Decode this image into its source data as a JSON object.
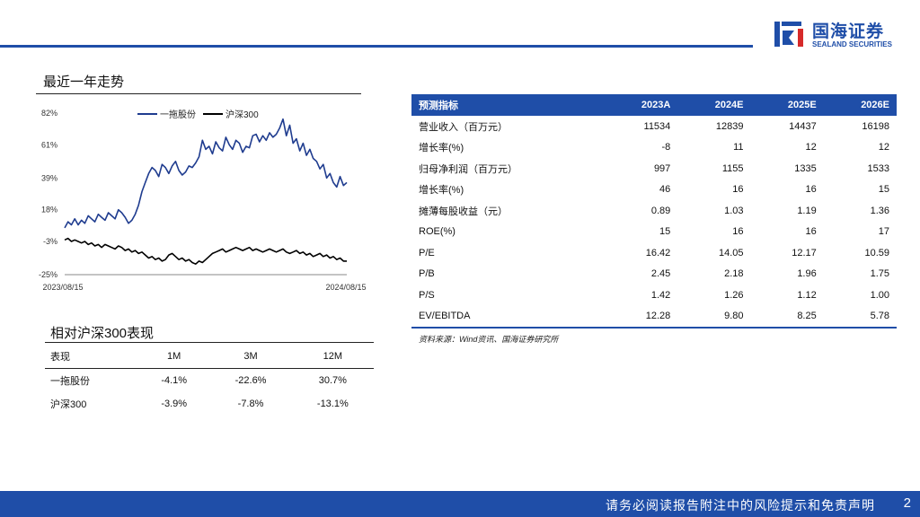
{
  "brand": {
    "name_cn": "国海证券",
    "name_en": "SEALAND SECURITIES",
    "color": "#1f4ea8"
  },
  "chart_section": {
    "title": "最近一年走势"
  },
  "chart_data": {
    "type": "line",
    "title": "最近一年走势",
    "y_ticks": [
      "82%",
      "61%",
      "39%",
      "18%",
      "-3%",
      "-25%"
    ],
    "y_tick_values": [
      82,
      61,
      39,
      18,
      -3,
      -25
    ],
    "ylim": [
      -25,
      82
    ],
    "x_tick_labels": [
      "2023/08/15",
      "2024/08/15"
    ],
    "legend_position": "top-right",
    "series": [
      {
        "name": "一拖股份",
        "color": "#1f3c8f",
        "values": [
          6,
          10,
          8,
          12,
          8,
          11,
          9,
          14,
          12,
          10,
          15,
          13,
          11,
          16,
          14,
          12,
          18,
          16,
          13,
          9,
          11,
          15,
          21,
          30,
          36,
          42,
          46,
          44,
          40,
          48,
          46,
          42,
          47,
          50,
          44,
          41,
          43,
          47,
          46,
          49,
          53,
          64,
          58,
          60,
          55,
          63,
          59,
          57,
          66,
          61,
          58,
          64,
          62,
          56,
          60,
          59,
          67,
          68,
          63,
          67,
          64,
          69,
          66,
          68,
          72,
          78,
          67,
          74,
          62,
          65,
          57,
          62,
          54,
          58,
          52,
          50,
          45,
          48,
          39,
          42,
          36,
          33,
          40,
          34,
          36
        ]
      },
      {
        "name": "沪深300",
        "color": "#000000",
        "values": [
          -2,
          -1,
          -3,
          -2,
          -3,
          -4,
          -3,
          -5,
          -4,
          -6,
          -5,
          -7,
          -5,
          -6,
          -7,
          -8,
          -6,
          -7,
          -9,
          -8,
          -10,
          -9,
          -11,
          -10,
          -12,
          -14,
          -13,
          -15,
          -14,
          -16,
          -15,
          -12,
          -11,
          -13,
          -15,
          -14,
          -16,
          -15,
          -17,
          -18,
          -16,
          -17,
          -15,
          -13,
          -11,
          -10,
          -9,
          -8,
          -10,
          -9,
          -8,
          -7,
          -8,
          -9,
          -8,
          -7,
          -9,
          -8,
          -9,
          -10,
          -9,
          -8,
          -9,
          -10,
          -9,
          -8,
          -10,
          -11,
          -10,
          -9,
          -11,
          -10,
          -12,
          -11,
          -13,
          -12,
          -11,
          -13,
          -12,
          -14,
          -13,
          -15,
          -14,
          -16,
          -16
        ]
      }
    ]
  },
  "perf_section": {
    "title": "相对沪深300表现",
    "headers": [
      "表现",
      "1M",
      "3M",
      "12M"
    ],
    "rows": [
      [
        "一拖股份",
        "-4.1%",
        "-22.6%",
        "30.7%"
      ],
      [
        "沪深300",
        "-3.9%",
        "-7.8%",
        "-13.1%"
      ]
    ]
  },
  "forecast": {
    "headers": [
      "预测指标",
      "2023A",
      "2024E",
      "2025E",
      "2026E"
    ],
    "rows": [
      [
        "营业收入（百万元）",
        "11534",
        "12839",
        "14437",
        "16198"
      ],
      [
        "增长率(%)",
        "-8",
        "11",
        "12",
        "12"
      ],
      [
        "归母净利润（百万元）",
        "997",
        "1155",
        "1335",
        "1533"
      ],
      [
        "增长率(%)",
        "46",
        "16",
        "16",
        "15"
      ],
      [
        "摊薄每股收益（元）",
        "0.89",
        "1.03",
        "1.19",
        "1.36"
      ],
      [
        "ROE(%)",
        "15",
        "16",
        "16",
        "17"
      ],
      [
        "P/E",
        "16.42",
        "14.05",
        "12.17",
        "10.59"
      ],
      [
        "P/B",
        "2.45",
        "2.18",
        "1.96",
        "1.75"
      ],
      [
        "P/S",
        "1.42",
        "1.26",
        "1.12",
        "1.00"
      ],
      [
        "EV/EBITDA",
        "12.28",
        "9.80",
        "8.25",
        "5.78"
      ]
    ],
    "source": "资料来源：Wind资讯、国海证券研究所"
  },
  "footer": {
    "disclaimer": "请务必阅读报告附注中的风险提示和免责声明",
    "page": "2"
  }
}
